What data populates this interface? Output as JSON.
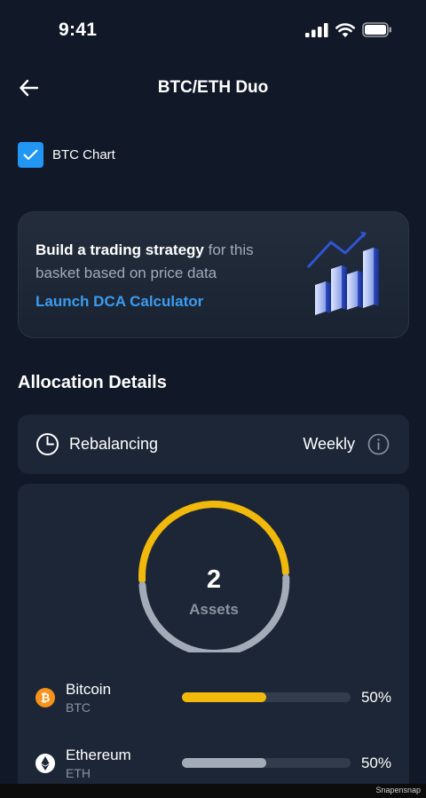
{
  "status_bar": {
    "time": "9:41",
    "icons": [
      "signal-icon",
      "wifi-icon",
      "battery-icon"
    ]
  },
  "nav": {
    "back_icon": "arrow-left-icon",
    "title": "BTC/ETH Duo"
  },
  "chart_toggle": {
    "label": "BTC Chart",
    "checked": true
  },
  "promo": {
    "strong": "Build a trading strategy",
    "rest": " for this basket based on price data",
    "link": "Launch DCA Calculator",
    "icon": "bar-chart-icon"
  },
  "allocation": {
    "title": "Allocation Details",
    "rebalancing_label": "Rebalancing",
    "rebalancing_value": "Weekly",
    "info_icon": "info-icon",
    "assets_count": "2",
    "assets_label": "Assets",
    "assets": [
      {
        "name": "Bitcoin",
        "ticker": "BTC",
        "percent": "50%",
        "fraction": 0.5,
        "color": "#f0b90b",
        "icon": "bitcoin-icon",
        "icon_color": "#f7931a"
      },
      {
        "name": "Ethereum",
        "ticker": "ETH",
        "percent": "50%",
        "fraction": 0.5,
        "color": "#a3abb8",
        "icon": "ethereum-icon",
        "icon_color": "#ffffff"
      }
    ]
  },
  "colors": {
    "background": "#111827",
    "card": "#1d2636",
    "accent_blue": "#3b9cf0",
    "gold": "#f0b90b"
  },
  "footer": {
    "watermark": "Snapensnap"
  }
}
